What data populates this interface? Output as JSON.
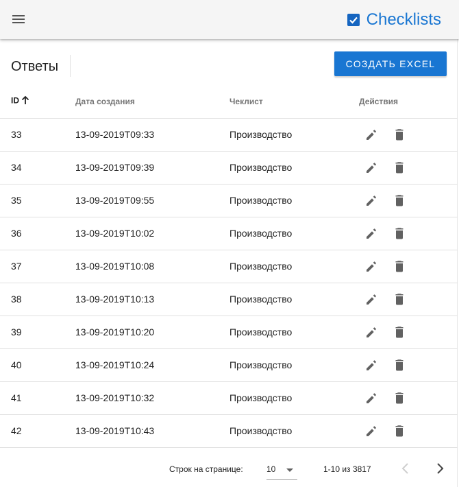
{
  "app": {
    "title": "Checklists",
    "accent": "#1976d2",
    "menu_icon": "menu-icon",
    "brand_icon": "checkbox-checked-icon"
  },
  "page": {
    "title": "Ответы",
    "create_button": "Создать EXCEL"
  },
  "table": {
    "headers": [
      "ID",
      "Дата создания",
      "Чеклист",
      "Действия"
    ],
    "sort": {
      "column": "ID",
      "direction": "asc",
      "icon": "arrow-up-icon"
    },
    "row_icons": {
      "edit": "pencil-icon",
      "delete": "trash-icon"
    },
    "rows": [
      {
        "id": "33",
        "date": "13-09-2019T09:33",
        "checklist": "Производство"
      },
      {
        "id": "34",
        "date": "13-09-2019T09:39",
        "checklist": "Производство"
      },
      {
        "id": "35",
        "date": "13-09-2019T09:55",
        "checklist": "Производство"
      },
      {
        "id": "36",
        "date": "13-09-2019T10:02",
        "checklist": "Производство"
      },
      {
        "id": "37",
        "date": "13-09-2019T10:08",
        "checklist": "Производство"
      },
      {
        "id": "38",
        "date": "13-09-2019T10:13",
        "checklist": "Производство"
      },
      {
        "id": "39",
        "date": "13-09-2019T10:20",
        "checklist": "Производство"
      },
      {
        "id": "40",
        "date": "13-09-2019T10:24",
        "checklist": "Производство"
      },
      {
        "id": "41",
        "date": "13-09-2019T10:32",
        "checklist": "Производство"
      },
      {
        "id": "42",
        "date": "13-09-2019T10:43",
        "checklist": "Производство"
      }
    ]
  },
  "pagination": {
    "rows_label": "Строк на странице:",
    "rows_per_page": "10",
    "range": "1-10 из 3817",
    "prev_icon": "chevron-left-icon",
    "next_icon": "chevron-right-icon"
  }
}
